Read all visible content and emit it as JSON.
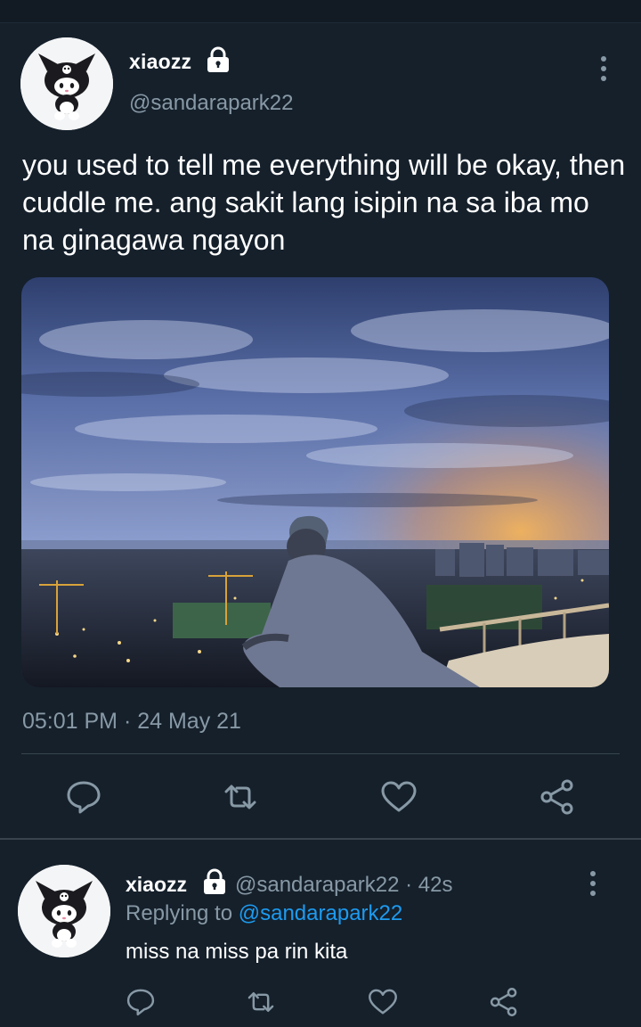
{
  "main_tweet": {
    "author_name": "xiaozz",
    "author_handle": "@sandarapark22",
    "protected_icon": "lock-icon",
    "text": "you used to tell me everything will be okay, then cuddle me. ang sakit lang isipin na sa iba mo na ginagawa ngayon",
    "timestamp": "05:01 PM · 24 May 21",
    "media": "photo",
    "actions": [
      "reply-icon",
      "retweet-icon",
      "like-icon",
      "share-icon"
    ]
  },
  "reply": {
    "author_name": "xiaozz",
    "author_handle": "@sandarapark22 · 42s",
    "replying_prefix": "Replying to",
    "replying_mention": "@sandarapark22",
    "text": "miss na miss pa rin kita",
    "actions": [
      "reply-icon",
      "retweet-icon",
      "like-icon",
      "share-icon"
    ]
  },
  "colors": {
    "background": "#15202b",
    "secondary_text": "#8899a6",
    "link": "#1d9bf0",
    "divider": "#38444d"
  }
}
